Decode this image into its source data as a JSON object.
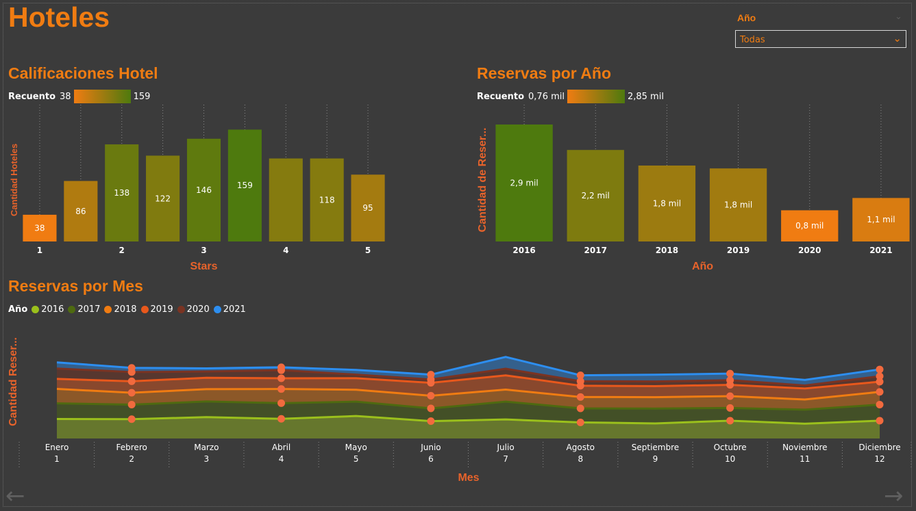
{
  "page": {
    "title": "Hoteles"
  },
  "slicer": {
    "label": "Año",
    "value": "Todas"
  },
  "colors": {
    "background": "#3b3b3b",
    "accent": "#f07c12",
    "axis_title": "#e8632b",
    "low": "#f07c12",
    "high": "#4e7a0e"
  },
  "hotel_chart": {
    "title": "Calificaciones Hotel",
    "legend": {
      "label": "Recuento",
      "min": "38",
      "max": "159"
    }
  },
  "year_chart": {
    "title": "Reservas por Año",
    "legend": {
      "label": "Recuento",
      "min": "0,76 mil",
      "max": "2,85 mil"
    }
  },
  "month_chart": {
    "title": "Reservas por Mes",
    "legend_label": "Año"
  },
  "icons": {
    "prev": "left-arrow-icon",
    "next": "right-arrow-icon"
  },
  "chart_data": [
    {
      "type": "bar",
      "title": "Calificaciones Hotel",
      "xlabel": "Stars",
      "ylabel": "Cantidad Hoteles",
      "categories": [
        "1",
        "1.5",
        "2",
        "2.5",
        "3",
        "3.5",
        "4",
        "4.5",
        "5"
      ],
      "tick_labels": [
        "1",
        "",
        "2",
        "",
        "3",
        "",
        "4",
        "",
        "5"
      ],
      "values": [
        38,
        86,
        138,
        122,
        146,
        159,
        118,
        118,
        95
      ],
      "data_labels": [
        "38",
        "86",
        "138",
        "122",
        "146",
        "159",
        "",
        "118",
        "95"
      ],
      "ylim": [
        0,
        175
      ],
      "color_scale": {
        "min": 38,
        "max": 159
      },
      "grid": "vertical dotted"
    },
    {
      "type": "bar",
      "title": "Reservas por Año",
      "xlabel": "Año",
      "ylabel": "Cantidad de Reser...",
      "categories": [
        "2016",
        "2017",
        "2018",
        "2019",
        "2020",
        "2021"
      ],
      "values": [
        2850,
        2230,
        1850,
        1780,
        760,
        1060
      ],
      "data_labels": [
        "2,9 mil",
        "2,2 mil",
        "1,8 mil",
        "1,8 mil",
        "0,8 mil",
        "1,1 mil"
      ],
      "ylim": [
        0,
        3000
      ],
      "color_scale": {
        "min": 760,
        "max": 2850
      },
      "grid": "vertical dotted"
    },
    {
      "type": "area",
      "stacked": true,
      "title": "Reservas por Mes",
      "xlabel": "Mes",
      "ylabel": "Cantidad Reser...",
      "categories": [
        "Enero",
        "Febrero",
        "Marzo",
        "Abril",
        "Mayo",
        "Junio",
        "Julio",
        "Agosto",
        "Septiembre",
        "Octubre",
        "Noviembre",
        "Diciembre"
      ],
      "category_numbers": [
        "1",
        "2",
        "3",
        "4",
        "5",
        "6",
        "7",
        "8",
        "9",
        "10",
        "11",
        "12"
      ],
      "series": [
        {
          "name": "2016",
          "color": "#9bc01c",
          "values": [
            230,
            228,
            252,
            232,
            265,
            205,
            225,
            190,
            178,
            210,
            175,
            210
          ]
        },
        {
          "name": "2017",
          "color": "#4e6a10",
          "values": [
            185,
            172,
            185,
            185,
            170,
            150,
            210,
            165,
            175,
            150,
            165,
            190
          ]
        },
        {
          "name": "2018",
          "color": "#f07c12",
          "values": [
            170,
            140,
            145,
            167,
            140,
            150,
            142,
            135,
            135,
            140,
            120,
            150
          ]
        },
        {
          "name": "2019",
          "color": "#e8581c",
          "values": [
            118,
            135,
            135,
            127,
            137,
            152,
            168,
            133,
            130,
            133,
            130,
            120
          ]
        },
        {
          "name": "2020",
          "color": "#7a3322",
          "values": [
            123,
            109,
            73,
            95,
            42,
            39,
            78,
            53,
            55,
            55,
            36,
            65
          ]
        },
        {
          "name": "2021",
          "color": "#2d8ef0",
          "values": [
            72,
            50,
            38,
            35,
            55,
            58,
            140,
            70,
            80,
            78,
            65,
            80
          ]
        }
      ],
      "ylim": [
        0,
        1300
      ],
      "grid": "vertical dotted"
    }
  ]
}
